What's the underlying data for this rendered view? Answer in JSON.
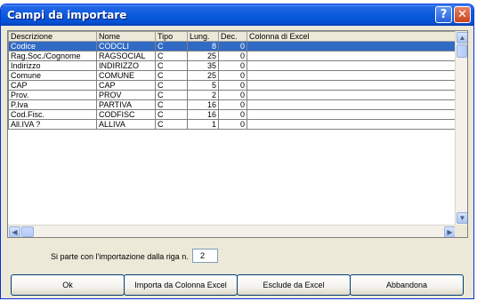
{
  "window": {
    "title": "Campi da importare",
    "help_glyph": "?",
    "close_glyph": "✕"
  },
  "table": {
    "columns": [
      "Descrizione",
      "Nome",
      "Tipo",
      "Lung.",
      "Dec.",
      "Colonna di Excel"
    ],
    "rows": [
      {
        "descrizione": "Codice",
        "nome": "CODCLI",
        "tipo": "C",
        "lung": "8",
        "dec": "0",
        "colonna": ""
      },
      {
        "descrizione": "Rag.Soc./Cognome",
        "nome": "RAGSOCIAL",
        "tipo": "C",
        "lung": "25",
        "dec": "0",
        "colonna": ""
      },
      {
        "descrizione": "Indirizzo",
        "nome": "INDIRIZZO",
        "tipo": "C",
        "lung": "35",
        "dec": "0",
        "colonna": ""
      },
      {
        "descrizione": "Comune",
        "nome": "COMUNE",
        "tipo": "C",
        "lung": "25",
        "dec": "0",
        "colonna": ""
      },
      {
        "descrizione": "CAP",
        "nome": "CAP",
        "tipo": "C",
        "lung": "5",
        "dec": "0",
        "colonna": ""
      },
      {
        "descrizione": "Prov.",
        "nome": "PROV",
        "tipo": "C",
        "lung": "2",
        "dec": "0",
        "colonna": ""
      },
      {
        "descrizione": "P.Iva",
        "nome": "PARTIVA",
        "tipo": "C",
        "lung": "16",
        "dec": "0",
        "colonna": ""
      },
      {
        "descrizione": "Cod.Fisc.",
        "nome": "CODFISC",
        "tipo": "C",
        "lung": "16",
        "dec": "0",
        "colonna": ""
      },
      {
        "descrizione": "All.IVA ?",
        "nome": "ALLIVA",
        "tipo": "C",
        "lung": "1",
        "dec": "0",
        "colonna": ""
      }
    ],
    "selected_row": 0
  },
  "scrollbars": {
    "up_glyph": "▲",
    "down_glyph": "▼",
    "left_glyph": "◀",
    "right_glyph": "▶"
  },
  "start_row": {
    "label": "Si parte con l'importazione dalla riga n.",
    "value": "2"
  },
  "buttons": {
    "ok": "Ok",
    "import_excel": "Importa da Colonna Excel",
    "exclude_excel": "Esclude da Excel",
    "abort": "Abbandona"
  }
}
